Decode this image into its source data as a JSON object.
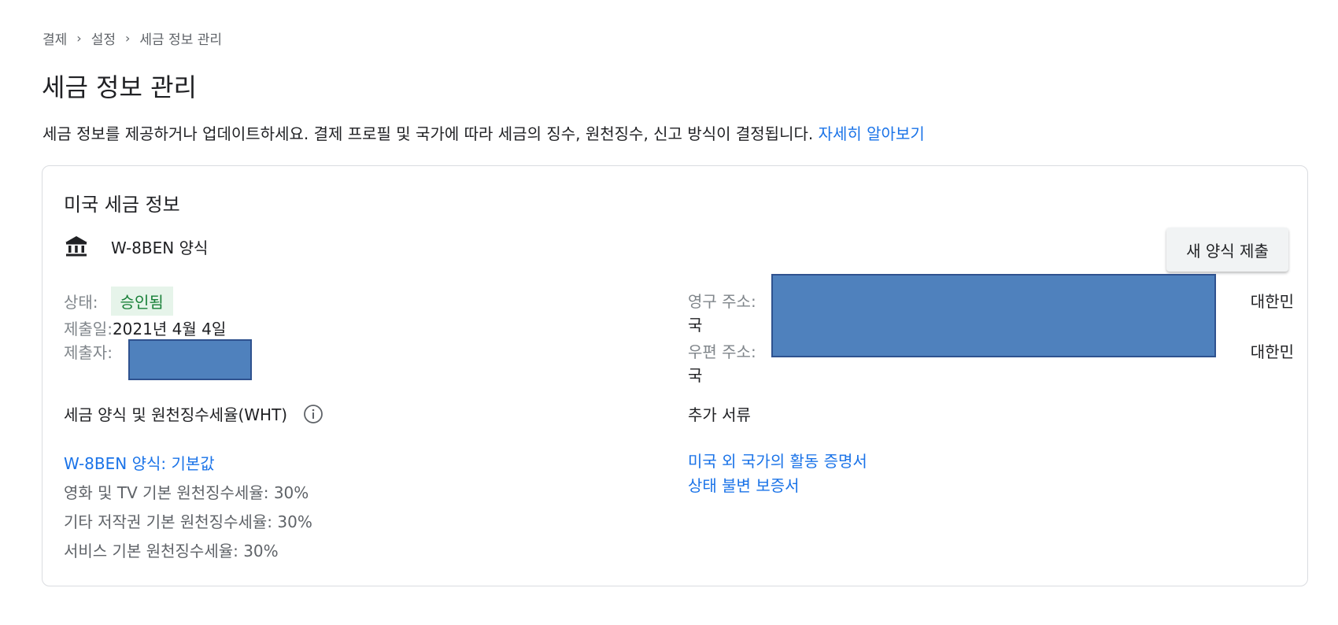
{
  "breadcrumb": {
    "items": [
      "결제",
      "설정",
      "세금 정보 관리"
    ],
    "separator": "›"
  },
  "page_title": "세금 정보 관리",
  "description": {
    "text": "세금 정보를 제공하거나 업데이트하세요. 결제 프로필 및 국가에 따라 세금의 징수, 원천징수, 신고 방식이 결정됩니다. ",
    "link": "자세히 알아보기"
  },
  "card": {
    "title": "미국 세금 정보",
    "form_icon": "bank-icon",
    "form_name": "W-8BEN 양식",
    "submit_button": "새 양식 제출",
    "status_label": "상태:",
    "status_value": "승인됨",
    "submitted_date_label": "제출일:",
    "submitted_date_value": "2021년 4월 4일",
    "submitter_label": "제출자:",
    "permanent_address_label": "영구 주소:",
    "mailing_address_label": "우편 주소:",
    "country_part1": "대한민",
    "country_part2": "국",
    "wht_heading": "세금 양식 및 원천징수세율(WHT)",
    "wht_info_icon": "info-icon",
    "wht_form_link": "W-8BEN 양식: 기본값",
    "wht_rates": [
      "영화 및 TV 기본 원천징수세율: 30%",
      "기타 저작권 기본 원천징수세율: 30%",
      "서비스 기본 원천징수세율: 30%"
    ],
    "docs_heading": "추가 서류",
    "docs_links": [
      "미국 외 국가의 활동 증명서",
      "상태 불변 보증서"
    ]
  },
  "colors": {
    "link": "#1a73e8",
    "status_bg": "#e6f4ea",
    "status_text": "#188038",
    "redaction": "#4f81bd"
  }
}
